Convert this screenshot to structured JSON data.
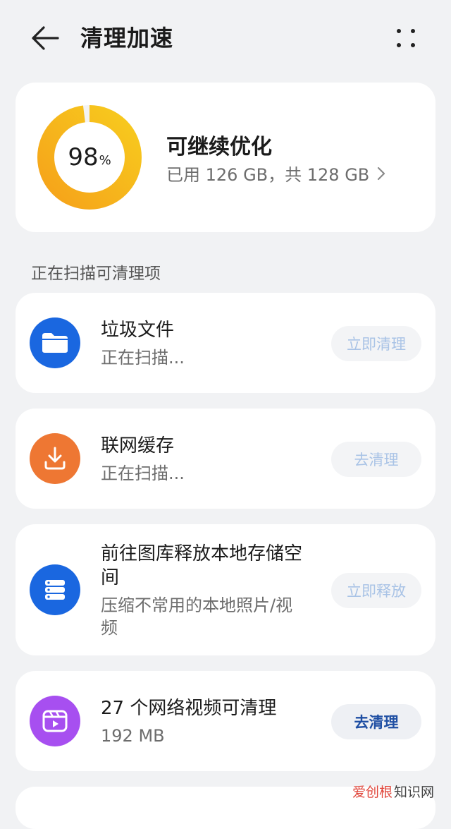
{
  "header": {
    "title": "清理加速",
    "back_icon": "arrow-left-icon",
    "more_icon": "more-dots-icon"
  },
  "storage": {
    "percent_used": 98,
    "percent_number": "98",
    "percent_symbol": "%",
    "status": "可继续优化",
    "detail": "已用 126 GB，共 128 GB",
    "ring_colors": {
      "start": "#f6a21a",
      "end": "#f7c91f"
    }
  },
  "section_label": "正在扫描可清理项",
  "items": [
    {
      "title": "垃圾文件",
      "subtitle": "正在扫描...",
      "button": "立即清理",
      "icon": "folder-icon",
      "icon_color": "#1a67e0",
      "button_enabled": false
    },
    {
      "title": "联网缓存",
      "subtitle": "正在扫描...",
      "button": "去清理",
      "icon": "download-icon",
      "icon_color": "#ee7733",
      "button_enabled": false
    },
    {
      "title_line1": "前往图库释放本地存储空",
      "title_line2": "间",
      "subtitle_line1": "压缩不常用的本地照片/视",
      "subtitle_line2": "频",
      "button": "立即释放",
      "icon": "storage-stack-icon",
      "icon_color": "#1a67e0",
      "button_enabled": false
    },
    {
      "title": "27 个网络视频可清理",
      "subtitle": "192 MB",
      "button": "去清理",
      "icon": "video-clapper-icon",
      "icon_color": "#a74ff0",
      "button_enabled": true
    }
  ],
  "watermark": {
    "part1": "爱创根",
    "part2": "知识网"
  }
}
